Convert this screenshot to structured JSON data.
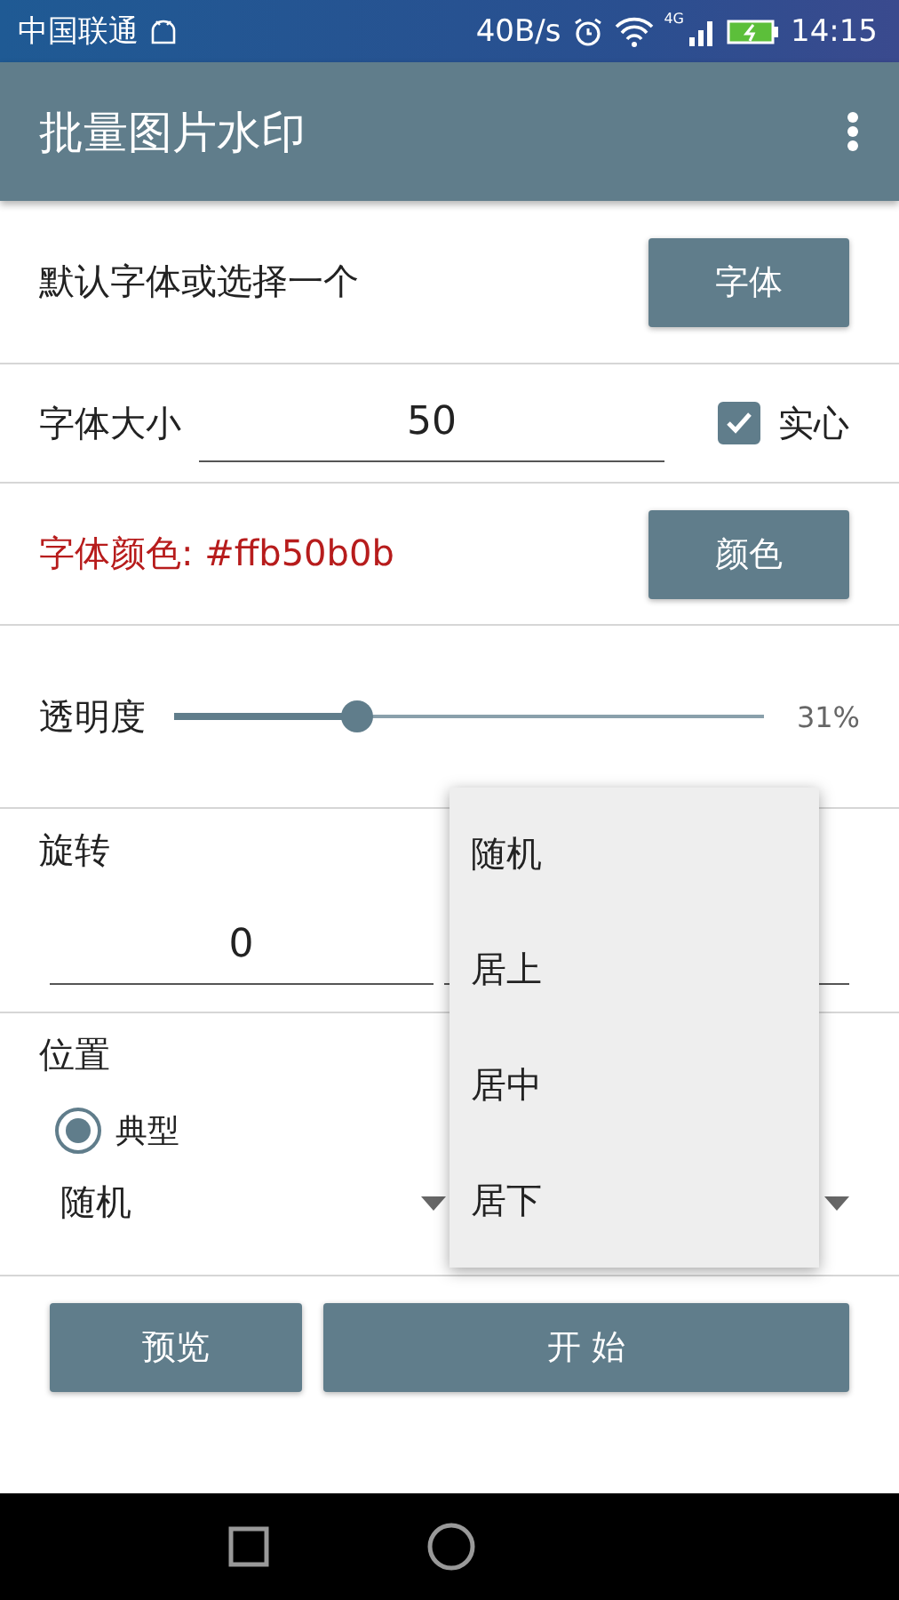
{
  "status_bar": {
    "carrier": "中国联通",
    "speed": "40B/s",
    "network": "4G",
    "time": "14:15"
  },
  "app_bar": {
    "title": "批量图片水印"
  },
  "font": {
    "label": "默认字体或选择一个",
    "button": "字体"
  },
  "font_size": {
    "label": "字体大小",
    "value": "50",
    "solid": {
      "label": "实心",
      "checked": true
    }
  },
  "font_color": {
    "label": "字体颜色: #ffb50b0b",
    "color": "#b71c1c",
    "button": "颜色"
  },
  "opacity": {
    "label": "透明度",
    "level": 0.31,
    "reading": "31%"
  },
  "rotation": {
    "label": "旋转",
    "value": "0"
  },
  "position": {
    "label": "位置",
    "radios": [
      {
        "label": "典型",
        "selected": true
      }
    ],
    "dropdown": "随机"
  },
  "buttons": {
    "preview": "预览",
    "start": "开 始"
  },
  "menu": [
    {
      "label": "随机"
    },
    {
      "label": "居上"
    },
    {
      "label": "居中"
    },
    {
      "label": "居下"
    }
  ]
}
